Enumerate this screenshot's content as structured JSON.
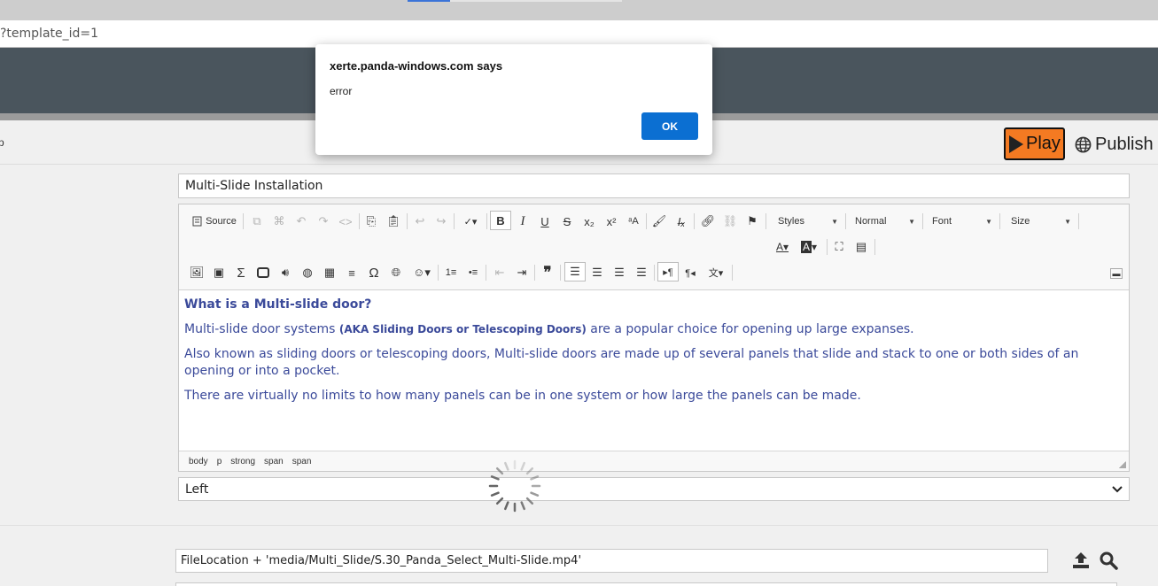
{
  "browser": {
    "url_fragment": "?template_id=1"
  },
  "toolbar": {
    "left_mark": "p",
    "play_label": "Play",
    "publish_label": "Publish"
  },
  "page_title_field": {
    "value": "Multi-Slide Installation"
  },
  "editor": {
    "toolbar": {
      "source_label": "Source",
      "styles_label": "Styles",
      "format_label": "Normal",
      "font_label": "Font",
      "size_label": "Size"
    },
    "content": {
      "heading": "What is a Multi-slide door?",
      "p1_before": "Multi-slide door systems ",
      "p1_strong": "(AKA Sliding Doors or Telescoping Doors)",
      "p1_after": " are a popular choice for opening up large expanses.",
      "p2": "Also known as sliding doors or telescoping doors, Multi-slide doors are made up of several panels that slide and stack to one or both sides of an opening or into a pocket.",
      "p3": "There are virtually no limits to how many panels can be in one system or how large the panels can be made."
    },
    "path": [
      "body",
      "p",
      "strong",
      "span",
      "span"
    ]
  },
  "align_select": {
    "value": "Left"
  },
  "file_field": {
    "value": "FileLocation + 'media/Multi_Slide/S.30_Panda_Select_Multi-Slide.mp4'"
  },
  "dialog": {
    "title": "xerte.panda-windows.com says",
    "message": "error",
    "ok_label": "OK"
  },
  "colors": {
    "play_button": "#f47a22",
    "header": "#4a555d",
    "dialog_ok": "#0b6fd2",
    "content_text": "#3b4a9a"
  }
}
